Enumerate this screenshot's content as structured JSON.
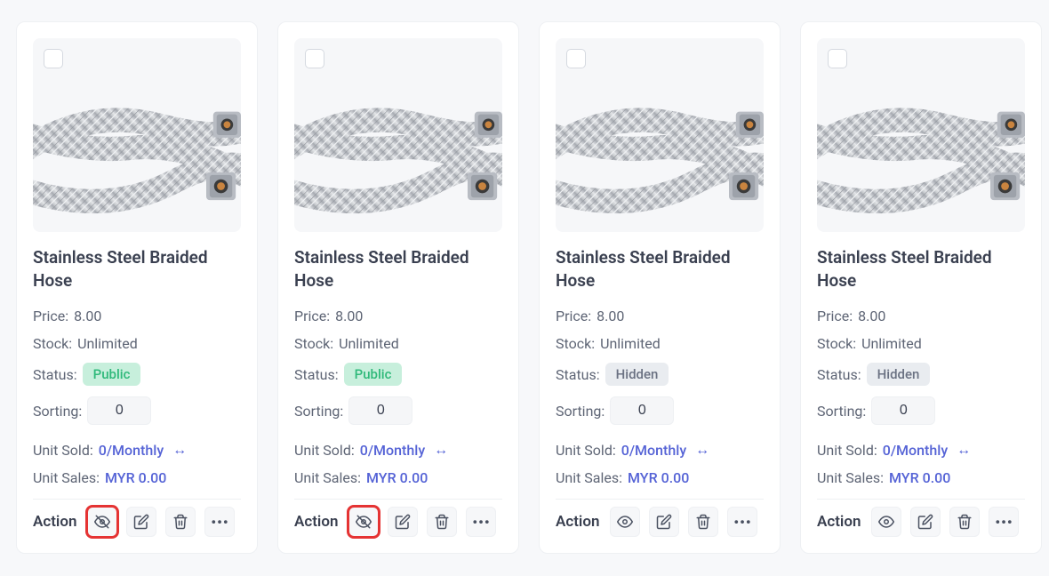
{
  "labels": {
    "price": "Price:",
    "stock": "Stock:",
    "status": "Status:",
    "sorting": "Sorting:",
    "unit_sold": "Unit Sold:",
    "unit_sales": "Unit Sales:",
    "action": "Action"
  },
  "status_text": {
    "public": "Public",
    "hidden": "Hidden"
  },
  "products": [
    {
      "title": "Stainless Steel Braided Hose",
      "price": "8.00",
      "stock": "Unlimited",
      "status": "public",
      "sorting": "0",
      "unit_sold": "0/Monthly",
      "unit_sales": "MYR 0.00",
      "visibility_icon": "eye-off",
      "highlight_visibility": true
    },
    {
      "title": "Stainless Steel Braided Hose",
      "price": "8.00",
      "stock": "Unlimited",
      "status": "public",
      "sorting": "0",
      "unit_sold": "0/Monthly",
      "unit_sales": "MYR 0.00",
      "visibility_icon": "eye-off",
      "highlight_visibility": true
    },
    {
      "title": "Stainless Steel Braided Hose",
      "price": "8.00",
      "stock": "Unlimited",
      "status": "hidden",
      "sorting": "0",
      "unit_sold": "0/Monthly",
      "unit_sales": "MYR 0.00",
      "visibility_icon": "eye",
      "highlight_visibility": false
    },
    {
      "title": "Stainless Steel Braided Hose",
      "price": "8.00",
      "stock": "Unlimited",
      "status": "hidden",
      "sorting": "0",
      "unit_sold": "0/Monthly",
      "unit_sales": "MYR 0.00",
      "visibility_icon": "eye",
      "highlight_visibility": false
    }
  ]
}
